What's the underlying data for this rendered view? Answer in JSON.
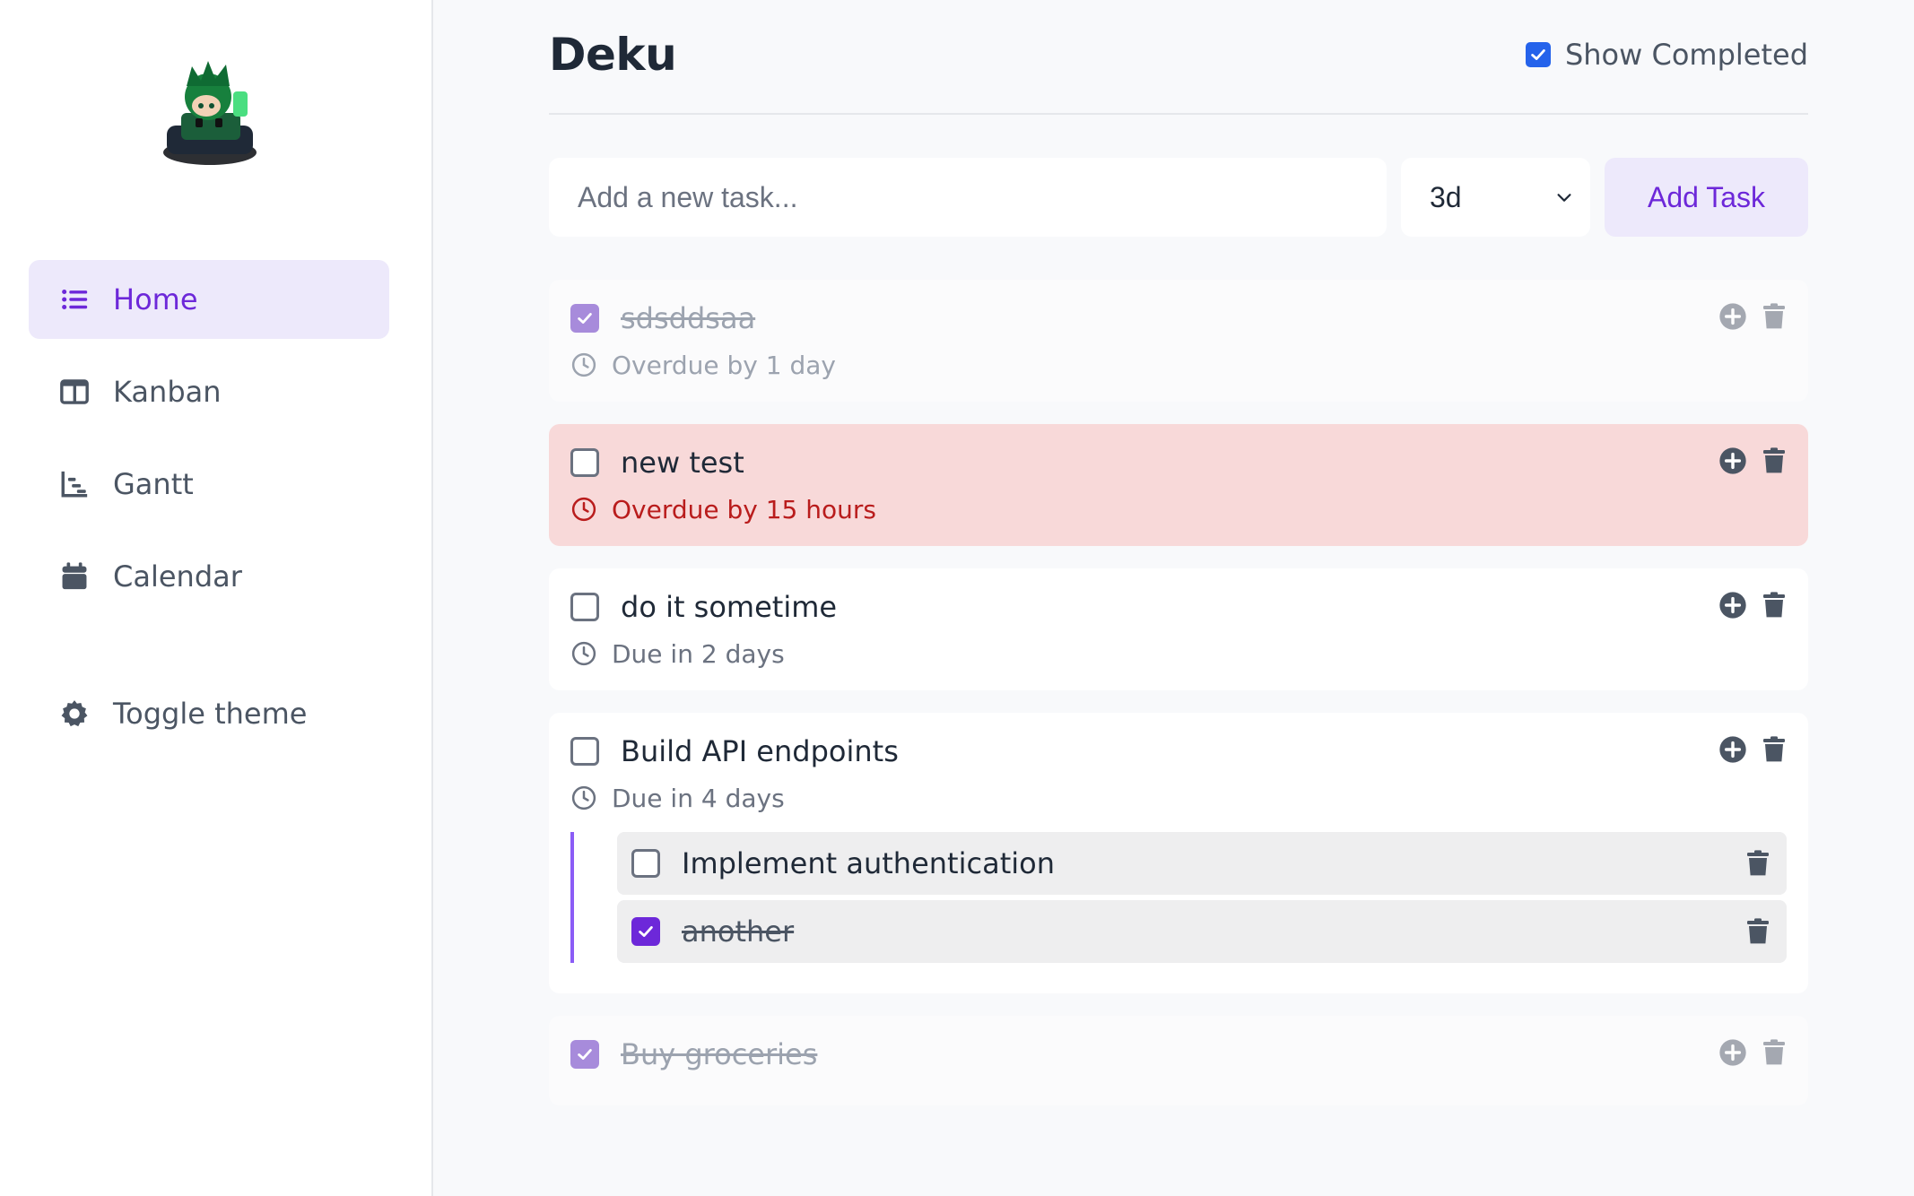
{
  "sidebar": {
    "logo": "deku-chibi-avatar",
    "items": [
      {
        "label": "Home",
        "icon": "list-icon",
        "active": true
      },
      {
        "label": "Kanban",
        "icon": "columns-icon",
        "active": false
      },
      {
        "label": "Gantt",
        "icon": "gantt-chart-icon",
        "active": false
      },
      {
        "label": "Calendar",
        "icon": "calendar-icon",
        "active": false
      }
    ],
    "toggle_theme": {
      "label": "Toggle theme",
      "icon": "gear-icon"
    }
  },
  "header": {
    "title": "Deku",
    "show_completed": {
      "label": "Show Completed",
      "checked": true
    }
  },
  "add_task": {
    "placeholder": "Add a new task...",
    "value": "",
    "duration": "3d",
    "button_label": "Add Task"
  },
  "tasks": [
    {
      "title": "sdsddsaa",
      "completed": true,
      "due": "Overdue by 1 day",
      "status": "completed"
    },
    {
      "title": "new test",
      "completed": false,
      "due": "Overdue by 15 hours",
      "status": "overdue"
    },
    {
      "title": "do it sometime",
      "completed": false,
      "due": "Due in 2 days",
      "status": "pending"
    },
    {
      "title": "Build API endpoints",
      "completed": false,
      "due": "Due in 4 days",
      "status": "pending",
      "subtasks": [
        {
          "title": "Implement authentication",
          "completed": false
        },
        {
          "title": "another",
          "completed": true
        }
      ]
    },
    {
      "title": "Buy groceries",
      "completed": true,
      "due": "",
      "status": "completed"
    }
  ],
  "colors": {
    "accent": "#6d28d9",
    "accent_soft": "#ede9fb",
    "overdue_bg": "#f8d9d9",
    "overdue_text": "#b91c1c",
    "checkbox_blue": "#2563eb"
  }
}
